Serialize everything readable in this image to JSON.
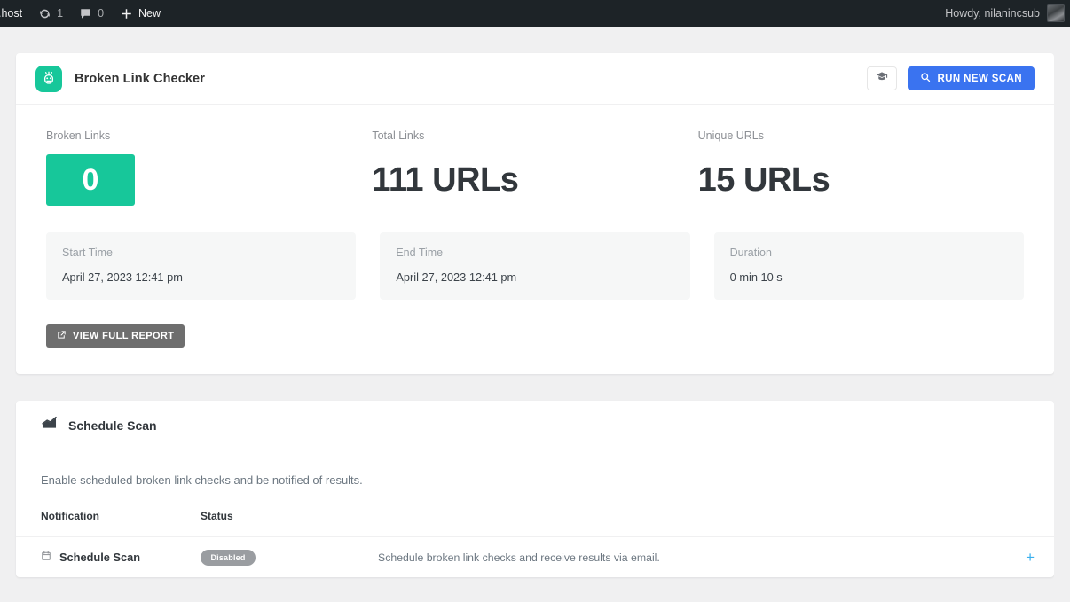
{
  "adminbar": {
    "site_name": ".host",
    "updates_count": "1",
    "comments_count": "0",
    "new_label": "New",
    "howdy": "Howdy, nilanincsub",
    "icons": {
      "updates": "updates-icon",
      "comments": "comments-icon",
      "new": "plus-icon",
      "avatar": "avatar"
    }
  },
  "plugin": {
    "title": "Broken Link Checker",
    "logo_color": "#17c79a",
    "docs_button_label": "",
    "scan_button_label": "RUN NEW SCAN",
    "scan_button_color": "#3a73f0"
  },
  "stats": [
    {
      "label": "Broken Links",
      "value": "0",
      "style": "badge",
      "color": "#17c79a"
    },
    {
      "label": "Total Links",
      "value": "111 URLs",
      "style": "text"
    },
    {
      "label": "Unique URLs",
      "value": "15 URLs",
      "style": "text"
    }
  ],
  "times": [
    {
      "label": "Start Time",
      "value": "April 27, 2023 12:41 pm"
    },
    {
      "label": "End Time",
      "value": "April 27, 2023 12:41 pm"
    },
    {
      "label": "Duration",
      "value": "0 min 10 s"
    }
  ],
  "report_button_label": "VIEW FULL REPORT",
  "schedule": {
    "title": "Schedule Scan",
    "description": "Enable scheduled broken link checks and be notified of results.",
    "columns": {
      "notification": "Notification",
      "status": "Status"
    },
    "rows": [
      {
        "name": "Schedule Scan",
        "status": "Disabled",
        "status_color": "#9a9da1",
        "description": "Schedule broken link checks and receive results via email.",
        "expand": "+"
      }
    ]
  }
}
